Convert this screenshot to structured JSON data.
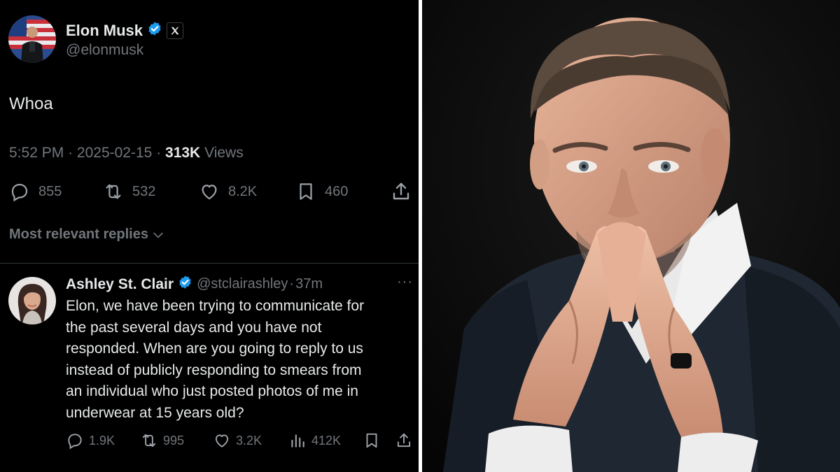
{
  "main_tweet": {
    "author_name": "Elon Musk",
    "handle": "@elonmusk",
    "text": "Whoa",
    "time": "5:52 PM",
    "date": "2025-02-15",
    "separator": "·",
    "views_count": "313K",
    "views_label": "Views",
    "icons": {
      "verified": "verified-badge-icon",
      "x_logo": "x-logo-icon"
    },
    "actions": {
      "replies": "855",
      "reposts": "532",
      "likes": "8.2K",
      "bookmarks": "460"
    }
  },
  "replies_section": {
    "sort_label": "Most relevant replies"
  },
  "reply": {
    "author_name": "Ashley St. Clair",
    "handle": "@stclairashley",
    "separator": "·",
    "age": "37m",
    "more": "···",
    "lines": [
      "Elon, we have been trying to communicate for",
      "the past several days and you have not",
      "responded. When are you going to reply to us",
      "instead of publicly responding to smears from",
      "an individual who just posted photos of me in",
      "underwear at 15 years old?"
    ],
    "actions": {
      "replies": "1.9K",
      "reposts": "995",
      "likes": "3.2K",
      "views": "412K"
    }
  },
  "colors": {
    "tweet_background": "#000000",
    "text_primary": "#e7e9ea",
    "text_secondary": "#71767b",
    "verified_blue": "#1d9bf0",
    "divider": "#2f3336",
    "photo_background": "#0b0b0b"
  },
  "photo": {
    "subject": "man-with-steepled-hands-photo"
  }
}
